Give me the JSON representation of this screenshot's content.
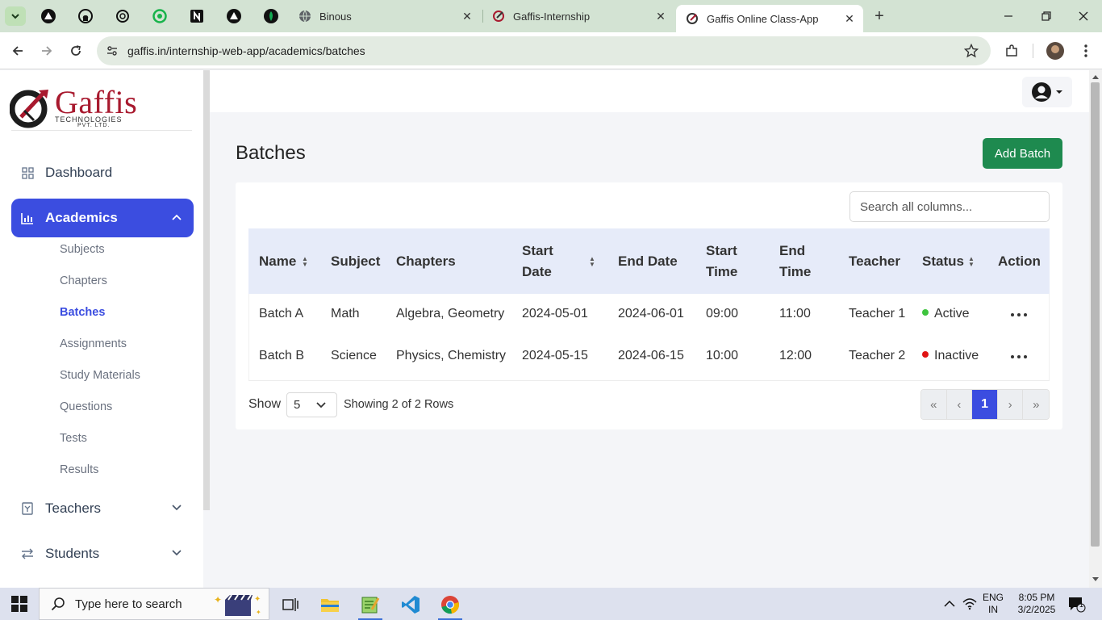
{
  "browser": {
    "tabs": [
      {
        "title": "Binous",
        "icon": "globe-icon"
      },
      {
        "title": "Gaffis-Internship",
        "icon": "gaffis-favicon"
      },
      {
        "title": "Gaffis Online Class-App",
        "icon": "gaffis-favicon",
        "active": true
      }
    ],
    "url": "gaffis.in/internship-web-app/academics/batches"
  },
  "logo": {
    "name": "Gaffis",
    "line1": "TECHNOLOGIES",
    "line2": "PVT. LTD."
  },
  "sidebar": {
    "dashboard": "Dashboard",
    "academics": "Academics",
    "academics_children": [
      "Subjects",
      "Chapters",
      "Batches",
      "Assignments",
      "Study Materials",
      "Questions",
      "Tests",
      "Results"
    ],
    "active_child": "Batches",
    "teachers": "Teachers",
    "students": "Students"
  },
  "page": {
    "title": "Batches",
    "add_button": "Add Batch",
    "search_placeholder": "Search all columns..."
  },
  "table": {
    "columns": [
      "Name",
      "Subject",
      "Chapters",
      "Start Date",
      "End Date",
      "Start Time",
      "End Time",
      "Teacher",
      "Status",
      "Action"
    ],
    "rows": [
      {
        "name": "Batch A",
        "subject": "Math",
        "chapters": "Algebra, Geometry",
        "start_date": "2024-05-01",
        "end_date": "2024-06-01",
        "start_time": "09:00",
        "end_time": "11:00",
        "teacher": "Teacher 1",
        "status": "Active"
      },
      {
        "name": "Batch B",
        "subject": "Science",
        "chapters": "Physics, Chemistry",
        "start_date": "2024-05-15",
        "end_date": "2024-06-15",
        "start_time": "10:00",
        "end_time": "12:00",
        "teacher": "Teacher 2",
        "status": "Inactive"
      }
    ],
    "status_colors": {
      "Active": "#3ec43e",
      "Inactive": "#e01414"
    }
  },
  "footer": {
    "show_label": "Show",
    "page_size": "5",
    "showing_text": "Showing 2 of 2 Rows",
    "pager": {
      "first": "«",
      "prev": "‹",
      "current": "1",
      "next": "›",
      "last": "»"
    }
  },
  "taskbar": {
    "search_placeholder": "Type here to search",
    "lang": "ENG",
    "region": "IN",
    "time": "8:05 PM",
    "date": "3/2/2025",
    "notification_count": "1"
  },
  "colors": {
    "accent": "#3b4de0",
    "add_button": "#1e8a4f",
    "brand": "#a8192e"
  }
}
